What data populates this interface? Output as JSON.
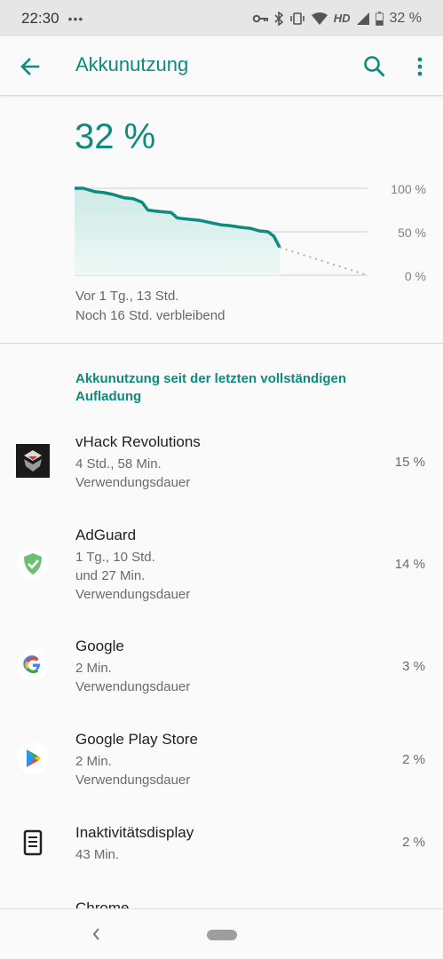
{
  "statusbar": {
    "time": "22:30",
    "dots": "•••",
    "network": "HD",
    "battery_pct": "32 %"
  },
  "appbar": {
    "title": "Akkunutzung",
    "icons": [
      "arrow-back-icon",
      "search-icon",
      "more-vert-icon"
    ]
  },
  "summary": {
    "percent": "32 %",
    "time_ago": "Vor 1 Tg., 13 Std.",
    "remaining": "Noch 16 Std. verbleibend"
  },
  "chart_data": {
    "type": "area",
    "y_ticks": [
      "100 %",
      "50 %",
      "0 %"
    ],
    "ylim": [
      0,
      100
    ],
    "x": [
      0,
      0.03,
      0.05,
      0.07,
      0.1,
      0.13,
      0.17,
      0.2,
      0.23,
      0.25,
      0.27,
      0.3,
      0.33,
      0.35,
      0.37,
      0.4,
      0.43,
      0.47,
      0.5,
      0.53,
      0.57,
      0.6,
      0.63,
      0.66,
      0.68,
      0.7
    ],
    "values": [
      100,
      100,
      98,
      96,
      95,
      93,
      89,
      88,
      84,
      75,
      74,
      73,
      72,
      66,
      65,
      64,
      63,
      60,
      58,
      57,
      55,
      54,
      51,
      50,
      45,
      32
    ],
    "projection": {
      "x": [
        0.7,
        1.0
      ],
      "values": [
        32,
        0
      ]
    },
    "colors": {
      "line": "#0e8a7e",
      "fill": "#dff1ef",
      "projection": "#b0b0b0",
      "grid": "#cfcfcf"
    }
  },
  "section": {
    "title": "Akkunutzung seit der letzten vollständigen Aufladung"
  },
  "apps": [
    {
      "name": "vHack Revolutions",
      "sub1": "4 Std., 58 Min.",
      "sub2": "Verwendungsdauer",
      "sub3": "",
      "percent": "15 %",
      "icon": "vhack-icon"
    },
    {
      "name": "AdGuard",
      "sub1": "1 Tg., 10 Std.",
      "sub2": "und 27 Min.",
      "sub3": "Verwendungsdauer",
      "percent": "14 %",
      "icon": "adguard-shield-icon"
    },
    {
      "name": "Google",
      "sub1": "2 Min.",
      "sub2": "Verwendungsdauer",
      "sub3": "",
      "percent": "3 %",
      "icon": "google-g-icon"
    },
    {
      "name": "Google Play Store",
      "sub1": "2 Min.",
      "sub2": "Verwendungsdauer",
      "sub3": "",
      "percent": "2 %",
      "icon": "play-store-icon"
    },
    {
      "name": "Inaktivitätsdisplay",
      "sub1": "43 Min.",
      "sub2": "",
      "sub3": "",
      "percent": "2 %",
      "icon": "phone-display-icon"
    },
    {
      "name": "Chrome",
      "sub1": "",
      "sub2": "",
      "sub3": "",
      "percent": "",
      "icon": ""
    }
  ],
  "theme": {
    "accent": "#0e8a7e"
  }
}
